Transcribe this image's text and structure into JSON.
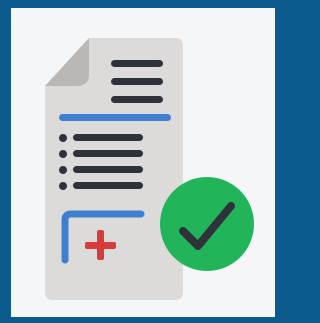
{
  "icon": {
    "name": "document-approved-icon",
    "colors": {
      "frame": "#0b5b8c",
      "background": "#f4f6f8",
      "paper": "#dcdbd9",
      "fold": "#b9b8b6",
      "lines": "#2f3238",
      "accent_blue": "#3f7fd0",
      "plus_red": "#d83b3b",
      "check_green": "#22b45a",
      "check_mark": "#2f3238"
    }
  }
}
